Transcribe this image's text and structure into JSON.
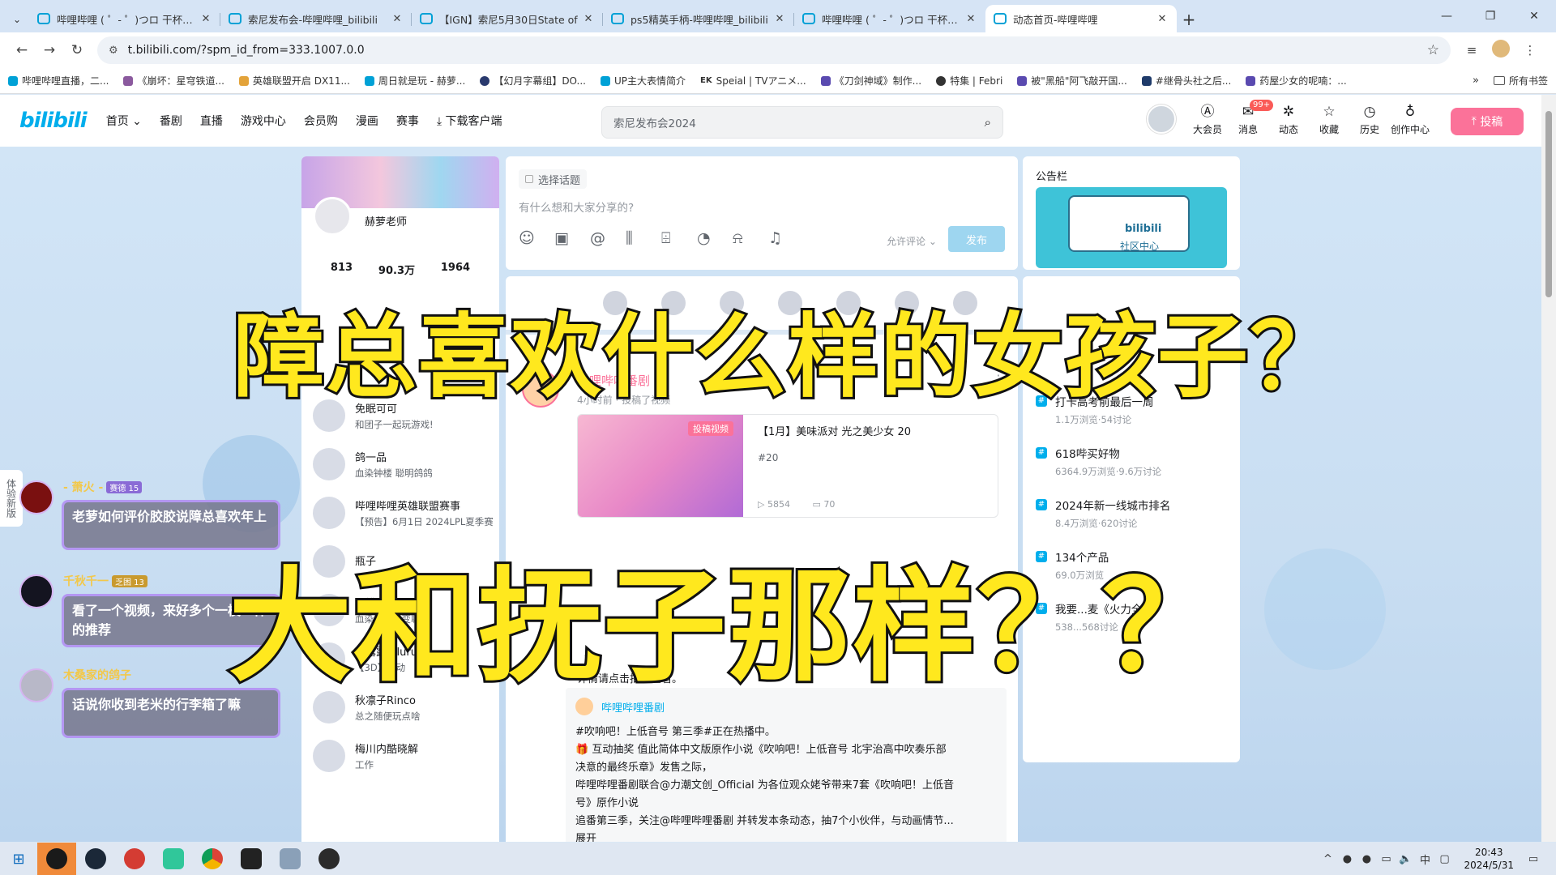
{
  "browser": {
    "tabs": [
      {
        "title": "哔哩哔哩 ( ゜- ゜)つロ 干杯~-bi",
        "active": false
      },
      {
        "title": "索尼发布会-哔哩哔哩_bilibili",
        "active": false
      },
      {
        "title": "【IGN】索尼5月30日State of",
        "active": false
      },
      {
        "title": "ps5精英手柄-哔哩哔哩_bilibili",
        "active": false
      },
      {
        "title": "哔哩哔哩 ( ゜- ゜)つロ 干杯~-bi",
        "active": false
      },
      {
        "title": "动态首页-哔哩哔哩",
        "active": true
      }
    ],
    "url": "t.bilibili.com/?spm_id_from=333.1007.0.0",
    "bookmarks": [
      "哔哩哔哩直播，二...",
      "《崩坏：星穹铁道...",
      "英雄联盟开启 DX11...",
      "周日就是玩 - 赫萝...",
      "【幻月字幕组】DO...",
      "UP主大表情简介",
      "Speial | TVアニメ...",
      "《刀剑神域》制作...",
      "特集 | Febri",
      "被\"黑船\"阿飞敲开国...",
      "#继骨头社之后...",
      "药屋少女的呢喃：..."
    ],
    "bookmarks_folder": "所有书签",
    "icon_ec": "EK"
  },
  "bili": {
    "logo": "bilibili",
    "nav": [
      "首页 ⌄",
      "番剧",
      "直播",
      "游戏中心",
      "会员购",
      "漫画",
      "赛事",
      "下载客户端"
    ],
    "search_placeholder": "索尼发布会2024",
    "icons": [
      {
        "icon": "vip-icon",
        "label": "大会员"
      },
      {
        "icon": "message-icon",
        "label": "消息",
        "badge": "99+"
      },
      {
        "icon": "dynamic-icon",
        "label": "动态"
      },
      {
        "icon": "favorite-icon",
        "label": "收藏"
      },
      {
        "icon": "history-icon",
        "label": "历史"
      },
      {
        "icon": "creator-icon",
        "label": "创作中心"
      }
    ],
    "upload": "投稿"
  },
  "profile": {
    "name": "赫萝老师",
    "stats": [
      "813",
      "90.3万",
      "1964"
    ]
  },
  "live_list": [
    {
      "title": "免眠可可",
      "sub": "和团子一起玩游戏!"
    },
    {
      "title": "鸽一品",
      "sub": "血染钟楼 聪明鸽鸽"
    },
    {
      "title": "哔哩哔哩英雄联盟赛事",
      "sub": "【预告】6月1日 2024LPL夏季赛"
    },
    {
      "title": "瓶子",
      "sub": ""
    },
    {
      "title": "小桃Cha",
      "sub": "血染！我要变聪明!"
    },
    {
      "title": "艾露露Ailurus",
      "sub": "【3D】联动"
    },
    {
      "title": "秋凛子Rinco",
      "sub": "总之随便玩点啥"
    },
    {
      "title": "梅川内酷晓解",
      "sub": "工作"
    }
  ],
  "composer": {
    "topic": "选择话题",
    "placeholder": "有什么想和大家分享的?",
    "allow_comment": "允许评论 ⌄",
    "publish": "发布"
  },
  "post": {
    "author": "哔哩哔哩番剧",
    "time": "4小时前 · 投稿了视频",
    "badge": "投稿视频",
    "video_title": "【1月】美味派对 光之美少女 20",
    "video_desc": "#20",
    "plays": "5854",
    "comments": "70",
    "lottery_tail": "详情请点击抽奖查看。"
  },
  "repost": {
    "author": "哔哩哔哩番剧",
    "lines": [
      "#吹响吧！上低音号 第三季#正在热播中。",
      "🎁 互动抽奖 值此简体中文版原作小说《吹响吧！上低音号 北宇治高中吹奏乐部",
      "决意的最终乐章》发售之际，",
      "哔哩哔哩番剧联合@力潮文创_Official 为各位观众姥爷带来7套《吹响吧！上低音",
      "号》原作小说",
      "追番第三季，关注@哔哩哔哩番剧 并转发本条动态，抽7个小伙伴，与动画情节...",
      "展开"
    ]
  },
  "notice": {
    "title": "公告栏",
    "logo": "bilibili",
    "sub": "社区中心"
  },
  "topics": [
    {
      "title": "打卡高考前最后一周",
      "sub": "1.1万浏览·54讨论"
    },
    {
      "title": "618哔买好物",
      "sub": "6364.9万浏览·9.6万讨论"
    },
    {
      "title": "2024年新一线城市排名",
      "sub": "8.4万浏览·620讨论"
    },
    {
      "title": "134个产品",
      "sub": "69.0万浏览"
    },
    {
      "title": "我要...麦《火力全开》",
      "sub": "538...568讨论"
    }
  ],
  "trial_tab": "体验新版",
  "chat": [
    {
      "name": "- 萧火 -",
      "badge": "赛德 15",
      "msg": "老萝如何评价胶胶说障总喜欢年上"
    },
    {
      "name": "千秋千一",
      "badge": "乏困 13",
      "msg": "看了一个视频，来好多个一模一样的推荐"
    },
    {
      "name": "木桑家的鸽子",
      "badge": "",
      "msg": "话说你收到老米的行李箱了嘛"
    }
  ],
  "captions": {
    "line1": "障总喜欢什么样的女孩子？",
    "line2": "大和抚子那样？？"
  },
  "taskbar": {
    "time": "20:43",
    "date": "2024/5/31",
    "apps": [
      {
        "icon": "bilibili-live-icon",
        "color": "#1a1a1a",
        "active": true
      },
      {
        "icon": "steam-icon",
        "color": "#1b2838"
      },
      {
        "icon": "netease-music-icon",
        "color": "#d43c33"
      },
      {
        "icon": "biliobs-icon",
        "color": "#30c79a"
      },
      {
        "icon": "chrome-icon",
        "color": "#4caf50"
      },
      {
        "icon": "capcut-icon",
        "color": "#222"
      },
      {
        "icon": "photo-app-icon",
        "color": "#8aa0b8"
      },
      {
        "icon": "obs-icon",
        "color": "#2b2b2b"
      }
    ]
  }
}
